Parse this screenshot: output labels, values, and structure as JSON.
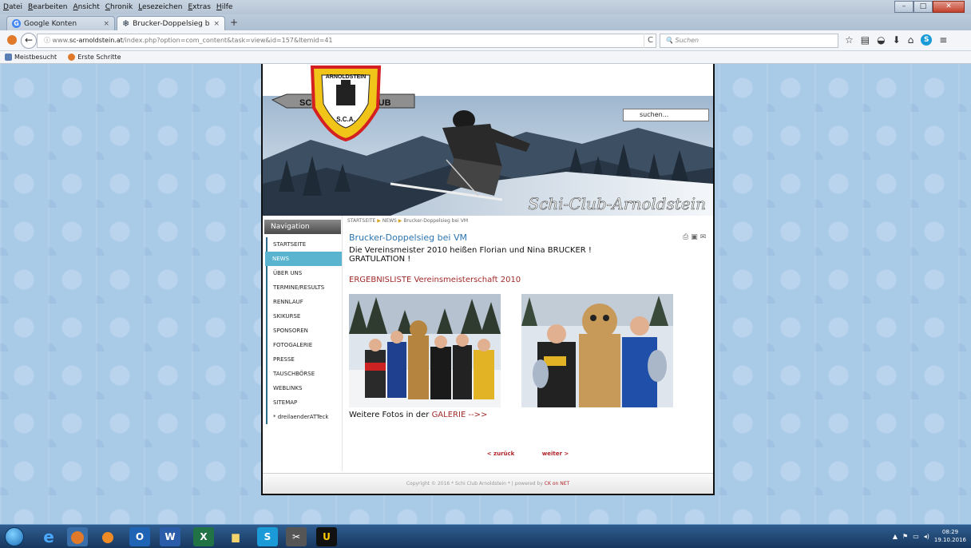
{
  "menubar": {
    "items": [
      "Datei",
      "Bearbeiten",
      "Ansicht",
      "Chronik",
      "Lesezeichen",
      "Extras",
      "Hilfe"
    ]
  },
  "tabs": [
    {
      "label": "Google Konten",
      "icon": "google-icon",
      "close": "×"
    },
    {
      "label": "Brucker-Doppelsieg bei V...",
      "icon": "snowflake-icon",
      "close": "×"
    }
  ],
  "new_tab": "+",
  "navbar": {
    "url_prefix": "www.",
    "url_domain": "sc-arnoldstein.at",
    "url_path": "/index.php?option=com_content&task=view&id=157&Itemid=41",
    "search_placeholder": "Suchen",
    "reload": "C"
  },
  "bookmarks": [
    {
      "label": "Meistbesucht"
    },
    {
      "label": "Erste Schritte"
    }
  ],
  "site": {
    "header_script": "Schi-Club-Arnoldstein",
    "logo_top": "ARNOLDSTEIN",
    "logo_left": "SCHI",
    "logo_right": "CLUB",
    "logo_bottom": "S.C.A.",
    "search_placeholder": "suchen...",
    "nav_title": "Navigation",
    "nav_items": [
      {
        "label": "STARTSEITE",
        "active": false
      },
      {
        "label": "NEWS",
        "active": true
      },
      {
        "label": "ÜBER UNS",
        "active": false
      },
      {
        "label": "TERMINE/RESULTS",
        "active": false
      },
      {
        "label": "RENNLAUF",
        "active": false
      },
      {
        "label": "SKIKURSE",
        "active": false
      },
      {
        "label": "SPONSOREN",
        "active": false
      },
      {
        "label": "FOTOGALERIE",
        "active": false
      },
      {
        "label": "PRESSE",
        "active": false
      },
      {
        "label": "TAUSCHBÖRSE",
        "active": false
      },
      {
        "label": "WEBLINKS",
        "active": false
      },
      {
        "label": "SITEMAP",
        "active": false
      },
      {
        "label": "* dreilaenderATTeck",
        "active": false
      }
    ],
    "breadcrumb": [
      "STARTSEITE",
      "NEWS",
      "Brucker-Doppelsieg bei VM"
    ],
    "article": {
      "title": "Brucker-Doppelsieg bei VM",
      "line1": "Die Vereinsmeister 2010 heißen Florian und Nina BRUCKER !",
      "line2": "GRATULATION !",
      "result_link": "ERGEBNISLISTE Vereinsmeisterschaft 2010",
      "more_text": "Weitere Fotos in der ",
      "more_link": "GALERIE -->>"
    },
    "pagenav": {
      "prev": "< zurück",
      "next": "weiter >"
    },
    "footer": {
      "copyright": "Copyright © 2016 * Schi Club Arnoldstein * | powered by ",
      "powered": "CK on NET"
    }
  },
  "taskbar": {
    "clock_time": "08:29",
    "clock_date": "19.10.2016"
  },
  "colors": {
    "link_blue": "#2b74b0",
    "link_red": "#a12a2a",
    "nav_active": "#5ab4d0",
    "page_bg": "#a9cbe8"
  }
}
